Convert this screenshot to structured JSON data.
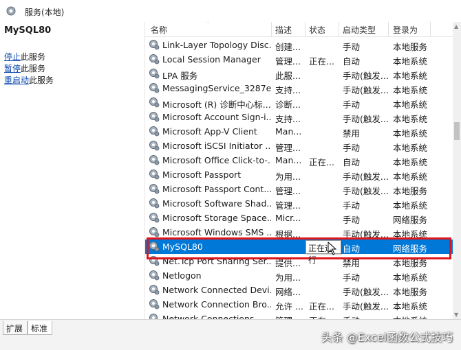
{
  "window": {
    "title": "服务(本地)",
    "icon": "gear-icon"
  },
  "left_pane": {
    "service_name": "MySQL80",
    "actions": [
      {
        "link": "停止",
        "suffix": "此服务"
      },
      {
        "link": "暂停",
        "suffix": "此服务"
      },
      {
        "link": "重启动",
        "suffix": "此服务"
      }
    ]
  },
  "columns": {
    "name": "名称",
    "desc": "描述",
    "status": "状态",
    "startup": "启动类型",
    "logon": "登录为"
  },
  "rows": [
    {
      "name": "Link-Layer Topology Disc...",
      "desc": "创建...",
      "status": "",
      "startup": "手动",
      "logon": "本地服务"
    },
    {
      "name": "Local Session Manager",
      "desc": "管理...",
      "status": "正在...",
      "startup": "自动",
      "logon": "本地系统"
    },
    {
      "name": "LPA 服务",
      "desc": "此服...",
      "status": "",
      "startup": "手动(触发...",
      "logon": "本地系统"
    },
    {
      "name": "MessagingService_3287e...",
      "desc": "支持...",
      "status": "",
      "startup": "手动(触发...",
      "logon": "本地系统"
    },
    {
      "name": "Microsoft (R) 诊断中心标...",
      "desc": "诊断...",
      "status": "",
      "startup": "手动",
      "logon": "本地系统"
    },
    {
      "name": "Microsoft Account Sign-i...",
      "desc": "支持...",
      "status": "",
      "startup": "手动(触发...",
      "logon": "本地系统"
    },
    {
      "name": "Microsoft App-V Client",
      "desc": "Man...",
      "status": "",
      "startup": "禁用",
      "logon": "本地系统"
    },
    {
      "name": "Microsoft iSCSI Initiator ...",
      "desc": "管理...",
      "status": "",
      "startup": "手动",
      "logon": "本地系统"
    },
    {
      "name": "Microsoft Office Click-to-...",
      "desc": "Man...",
      "status": "正在...",
      "startup": "自动",
      "logon": "本地系统"
    },
    {
      "name": "Microsoft Passport",
      "desc": "为用...",
      "status": "",
      "startup": "手动(触发...",
      "logon": "本地系统"
    },
    {
      "name": "Microsoft Passport Cont...",
      "desc": "管理...",
      "status": "",
      "startup": "手动(触发...",
      "logon": "本地服务"
    },
    {
      "name": "Microsoft Software Shad...",
      "desc": "管理...",
      "status": "",
      "startup": "手动",
      "logon": "本地系统"
    },
    {
      "name": "Microsoft Storage Space...",
      "desc": "Micr...",
      "status": "",
      "startup": "手动",
      "logon": "网络服务"
    },
    {
      "name": "Microsoft Windows SMS ...",
      "desc": "根据...",
      "status": "",
      "startup": "手动(触发...",
      "logon": "本地系统"
    },
    {
      "name": "MySQL80",
      "desc": "",
      "status": "",
      "startup": "自动",
      "logon": "网络服务",
      "selected": true
    },
    {
      "name": "Net.Tcp Port Sharing Ser...",
      "desc": "提供...",
      "status": "",
      "startup": "禁用",
      "logon": "本地服务"
    },
    {
      "name": "Netlogon",
      "desc": "为用...",
      "status": "",
      "startup": "手动",
      "logon": "本地系统"
    },
    {
      "name": "Network Connected Devi...",
      "desc": "网络...",
      "status": "",
      "startup": "手动(触发...",
      "logon": "本地服务"
    },
    {
      "name": "Network Connection Bro...",
      "desc": "允许 ...",
      "status": "正在...",
      "startup": "手动(触发...",
      "logon": "本地系统"
    },
    {
      "name": "Network Connections",
      "desc": "管理...",
      "status": "正在...",
      "startup": "手动",
      "logon": "本地系统"
    }
  ],
  "tooltip": "正在运行",
  "tabs": [
    "扩展",
    "标准"
  ],
  "watermark": "头条 @Excel函数公式技巧",
  "colors": {
    "selection": "#0078d7",
    "highlight_box": "#e0141b",
    "link": "#0645ad"
  }
}
